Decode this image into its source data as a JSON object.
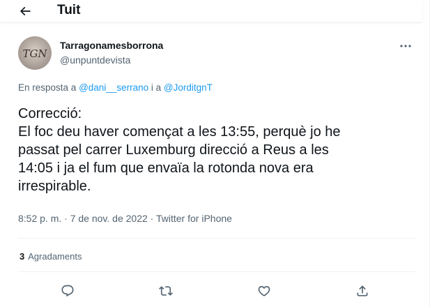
{
  "header": {
    "back_icon": "arrow-left-icon",
    "title": "Tuit"
  },
  "author": {
    "name": "Tarragonamesborrona",
    "handle": "@unpuntdevista",
    "avatar_text": "TGN"
  },
  "reply": {
    "prefix": "En resposta a",
    "mention1": "@dani__serrano",
    "joiner": "i a",
    "mention2": "@JorditgnT"
  },
  "tweet": {
    "lines": [
      "Correcció:",
      "El foc deu haver començat a les 13:55, perquè jo he",
      "passat pel carrer Luxemburg direcció a Reus a les",
      "14:05 i ja el fum que envaïa la rotonda nova era",
      "irrespirable."
    ]
  },
  "meta": {
    "time": "8:52 p. m.",
    "date": "7 de nov. de 2022",
    "source": "Twitter for iPhone",
    "separator": "·"
  },
  "likes": {
    "count": "3",
    "label": "Agradaments"
  },
  "actions": [
    {
      "name": "reply",
      "icon": "reply-icon"
    },
    {
      "name": "retweet",
      "icon": "retweet-icon"
    },
    {
      "name": "like",
      "icon": "heart-icon"
    },
    {
      "name": "share",
      "icon": "share-icon"
    }
  ],
  "colors": {
    "accent": "#1d9bf0",
    "text_primary": "#0f1419",
    "text_secondary": "#536471",
    "divider": "#eff3f4"
  }
}
